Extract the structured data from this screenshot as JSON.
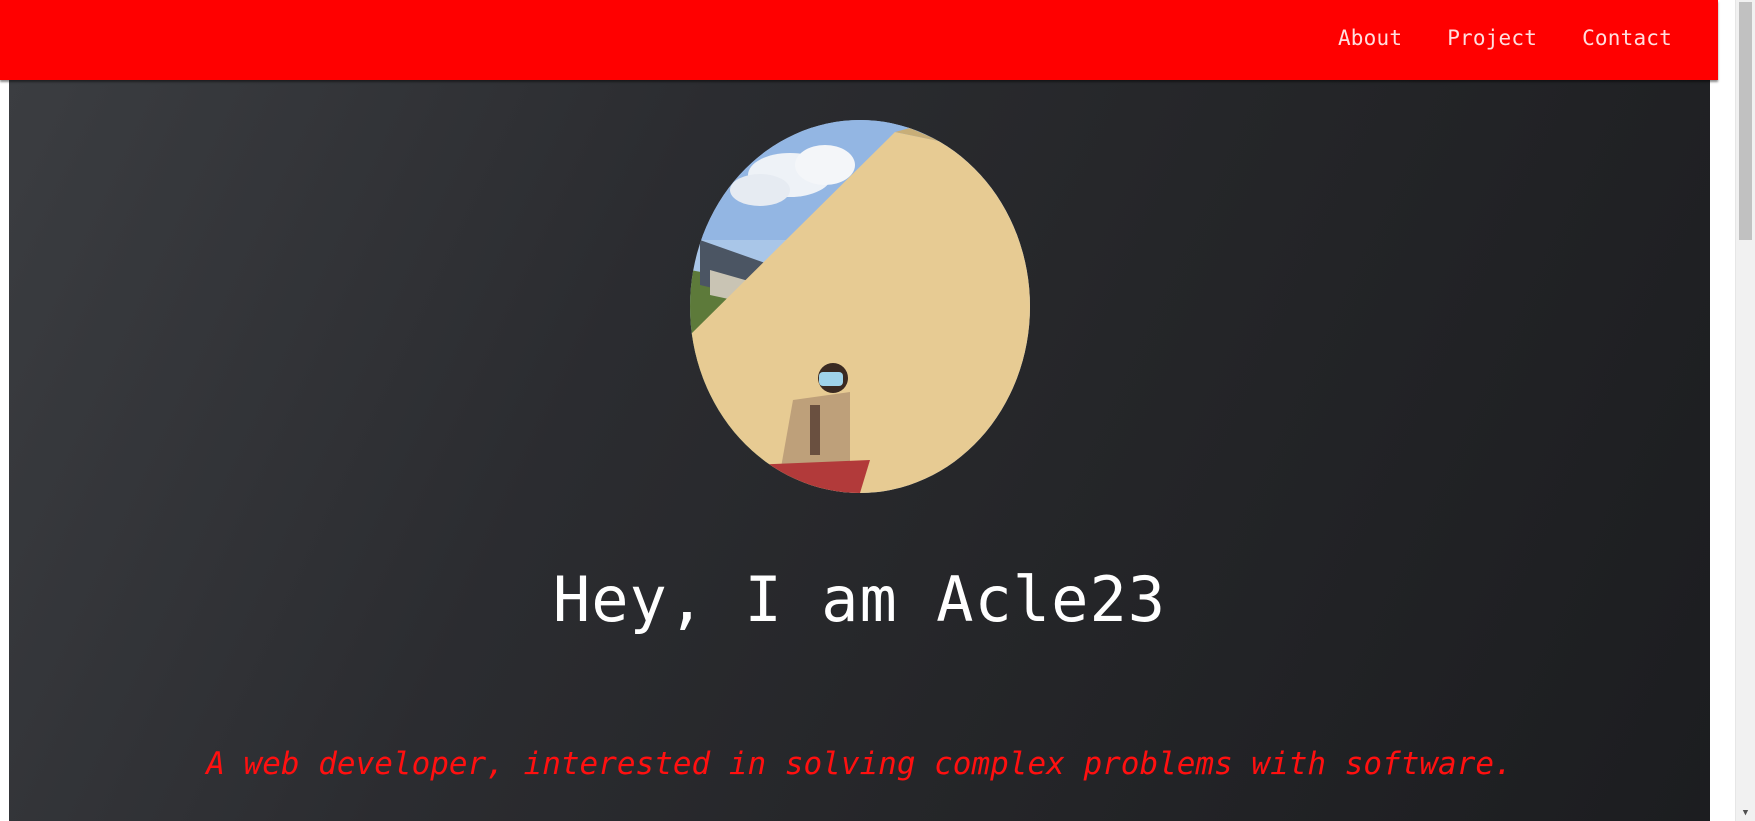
{
  "nav": {
    "links": [
      "About",
      "Project",
      "Contact"
    ]
  },
  "hero": {
    "avatar_alt": "profile photo",
    "greeting": "Hey, I am Acle23",
    "tagline": "A web developer, interested in solving complex problems with software."
  },
  "colors": {
    "navbar": "#ff0000",
    "nav_text": "#ffdede",
    "hero_background": "#2a2b2f",
    "greeting_text": "#ffffff",
    "tagline_text": "#ff1010"
  },
  "scrollbar": {
    "arrow_icon": "down-arrow-icon"
  }
}
